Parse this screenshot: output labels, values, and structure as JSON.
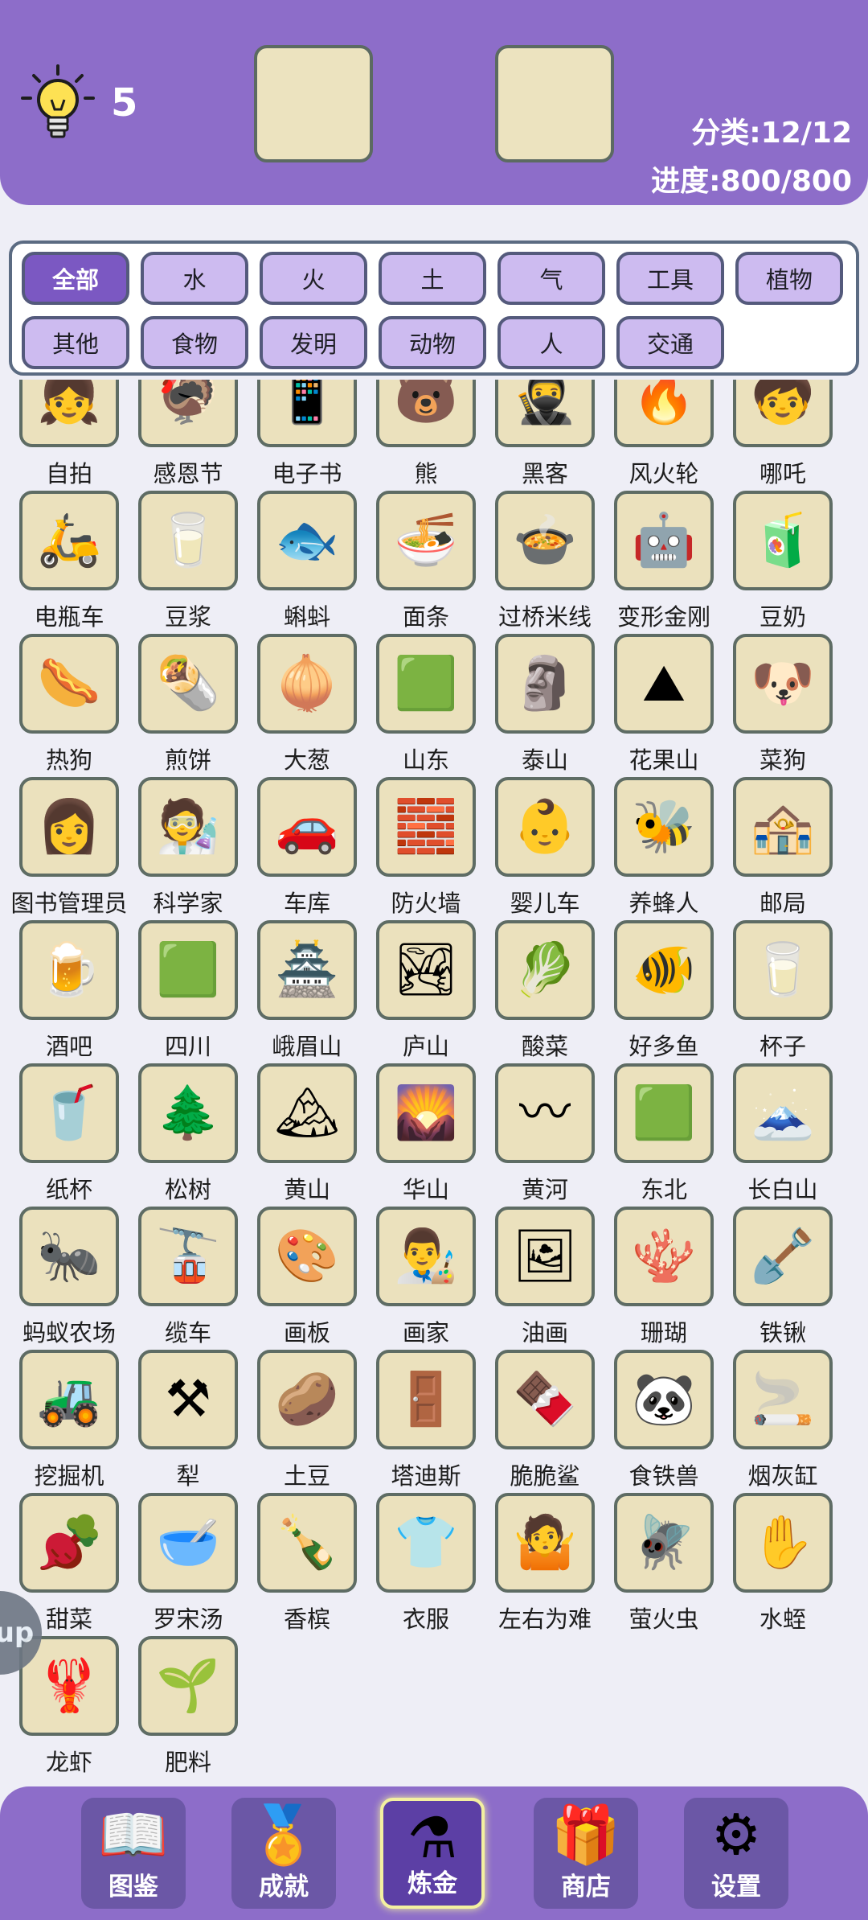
{
  "header": {
    "hint_icon": "lightbulb-icon",
    "hint_count": "5",
    "category_stat": "分类:12/12",
    "progress_stat": "进度:800/800"
  },
  "filters": [
    "全部",
    "水",
    "火",
    "土",
    "气",
    "工具",
    "植物",
    "其他",
    "食物",
    "发明",
    "动物",
    "人",
    "交通"
  ],
  "active_filter": "全部",
  "items": [
    {
      "label": "自拍",
      "icon": "👧"
    },
    {
      "label": "感恩节",
      "icon": "🦃"
    },
    {
      "label": "电子书",
      "icon": "📱"
    },
    {
      "label": "熊",
      "icon": "🐻"
    },
    {
      "label": "黑客",
      "icon": "🥷"
    },
    {
      "label": "风火轮",
      "icon": "🔥"
    },
    {
      "label": "哪吒",
      "icon": "🧒"
    },
    {
      "label": "电瓶车",
      "icon": "🛵"
    },
    {
      "label": "豆浆",
      "icon": "🥛"
    },
    {
      "label": "蝌蚪",
      "icon": "🐟"
    },
    {
      "label": "面条",
      "icon": "🍜"
    },
    {
      "label": "过桥米线",
      "icon": "🍲"
    },
    {
      "label": "变形金刚",
      "icon": "🤖"
    },
    {
      "label": "豆奶",
      "icon": "🧃"
    },
    {
      "label": "热狗",
      "icon": "🌭"
    },
    {
      "label": "煎饼",
      "icon": "🌯"
    },
    {
      "label": "大葱",
      "icon": "🧅"
    },
    {
      "label": "山东",
      "icon": "🟩"
    },
    {
      "label": "泰山",
      "icon": "🗿"
    },
    {
      "label": "花果山",
      "icon": "⛰"
    },
    {
      "label": "菜狗",
      "icon": "🐶"
    },
    {
      "label": "图书管理员",
      "icon": "👩"
    },
    {
      "label": "科学家",
      "icon": "🧑‍🔬"
    },
    {
      "label": "车库",
      "icon": "🚗"
    },
    {
      "label": "防火墙",
      "icon": "🧱"
    },
    {
      "label": "婴儿车",
      "icon": "👶"
    },
    {
      "label": "养蜂人",
      "icon": "🐝"
    },
    {
      "label": "邮局",
      "icon": "🏤"
    },
    {
      "label": "酒吧",
      "icon": "🍺"
    },
    {
      "label": "四川",
      "icon": "🟩"
    },
    {
      "label": "峨眉山",
      "icon": "🏯"
    },
    {
      "label": "庐山",
      "icon": "🏞"
    },
    {
      "label": "酸菜",
      "icon": "🥬"
    },
    {
      "label": "好多鱼",
      "icon": "🐠"
    },
    {
      "label": "杯子",
      "icon": "🥛"
    },
    {
      "label": "纸杯",
      "icon": "🥤"
    },
    {
      "label": "松树",
      "icon": "🌲"
    },
    {
      "label": "黄山",
      "icon": "🏔"
    },
    {
      "label": "华山",
      "icon": "🌄"
    },
    {
      "label": "黄河",
      "icon": "〰"
    },
    {
      "label": "东北",
      "icon": "🟩"
    },
    {
      "label": "长白山",
      "icon": "🗻"
    },
    {
      "label": "蚂蚁农场",
      "icon": "🐜"
    },
    {
      "label": "缆车",
      "icon": "🚡"
    },
    {
      "label": "画板",
      "icon": "🎨"
    },
    {
      "label": "画家",
      "icon": "👨‍🎨"
    },
    {
      "label": "油画",
      "icon": "🖼"
    },
    {
      "label": "珊瑚",
      "icon": "🪸"
    },
    {
      "label": "铁锹",
      "icon": "🪏"
    },
    {
      "label": "挖掘机",
      "icon": "🚜"
    },
    {
      "label": "犁",
      "icon": "⚒"
    },
    {
      "label": "土豆",
      "icon": "🥔"
    },
    {
      "label": "塔迪斯",
      "icon": "🚪"
    },
    {
      "label": "脆脆鲨",
      "icon": "🍫"
    },
    {
      "label": "食铁兽",
      "icon": "🐼"
    },
    {
      "label": "烟灰缸",
      "icon": "🚬"
    },
    {
      "label": "甜菜",
      "icon": "🫜"
    },
    {
      "label": "罗宋汤",
      "icon": "🥣"
    },
    {
      "label": "香槟",
      "icon": "🍾"
    },
    {
      "label": "衣服",
      "icon": "👕"
    },
    {
      "label": "左右为难",
      "icon": "🤷"
    },
    {
      "label": "萤火虫",
      "icon": "🪰"
    },
    {
      "label": "水蛭",
      "icon": "✋"
    },
    {
      "label": "龙虾",
      "icon": "🦞"
    },
    {
      "label": "肥料",
      "icon": "🌱"
    }
  ],
  "side_button": {
    "label": "up"
  },
  "nav": [
    {
      "label": "图鉴",
      "icon": "📖"
    },
    {
      "label": "成就",
      "icon": "🏅"
    },
    {
      "label": "炼金",
      "icon": "⚗"
    },
    {
      "label": "商店",
      "icon": "🎁"
    },
    {
      "label": "设置",
      "icon": "⚙"
    }
  ],
  "active_nav": "炼金"
}
